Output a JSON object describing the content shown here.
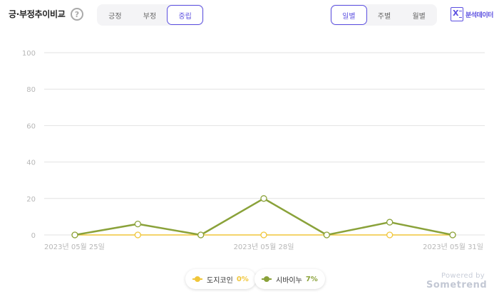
{
  "header": {
    "title": "긍·부정추이비교",
    "help_icon_glyph": "?",
    "sentiment_tabs": [
      {
        "label": "긍정",
        "active": false
      },
      {
        "label": "부정",
        "active": false
      },
      {
        "label": "중립",
        "active": true
      }
    ],
    "period_tabs": [
      {
        "label": "일별",
        "active": true
      },
      {
        "label": "주별",
        "active": false
      },
      {
        "label": "월별",
        "active": false
      }
    ],
    "export_label": "분석데이터",
    "export_icon": "excel-icon"
  },
  "colors": {
    "accent": "#5b4fe0",
    "series_1": "#f0c63a",
    "series_2": "#8aa23a",
    "grid": "#e2e2e2",
    "axis_text": "#b7b7b7"
  },
  "chart_data": {
    "type": "line",
    "x": [
      "2023-05-25",
      "2023-05-26",
      "2023-05-27",
      "2023-05-28",
      "2023-05-29",
      "2023-05-30",
      "2023-05-31"
    ],
    "x_tick_labels": [
      {
        "index": 0,
        "label": "2023년 05월 25일"
      },
      {
        "index": 3,
        "label": "2023년 05월 28일"
      },
      {
        "index": 6,
        "label": "2023년 05월 31일"
      }
    ],
    "y_ticks": [
      0,
      20,
      40,
      60,
      80,
      100
    ],
    "ylim": [
      0,
      100
    ],
    "grid": true,
    "legend_position": "bottom-center",
    "series": [
      {
        "name": "도지코인",
        "percent_label": "0%",
        "values": [
          0,
          0,
          0,
          0,
          0,
          0,
          0
        ]
      },
      {
        "name": "시바이누",
        "percent_label": "7%",
        "values": [
          0,
          6,
          0,
          20,
          0,
          7,
          0
        ]
      }
    ]
  },
  "footer": {
    "powered_by": "Powered by",
    "brand": "Sometrend"
  }
}
